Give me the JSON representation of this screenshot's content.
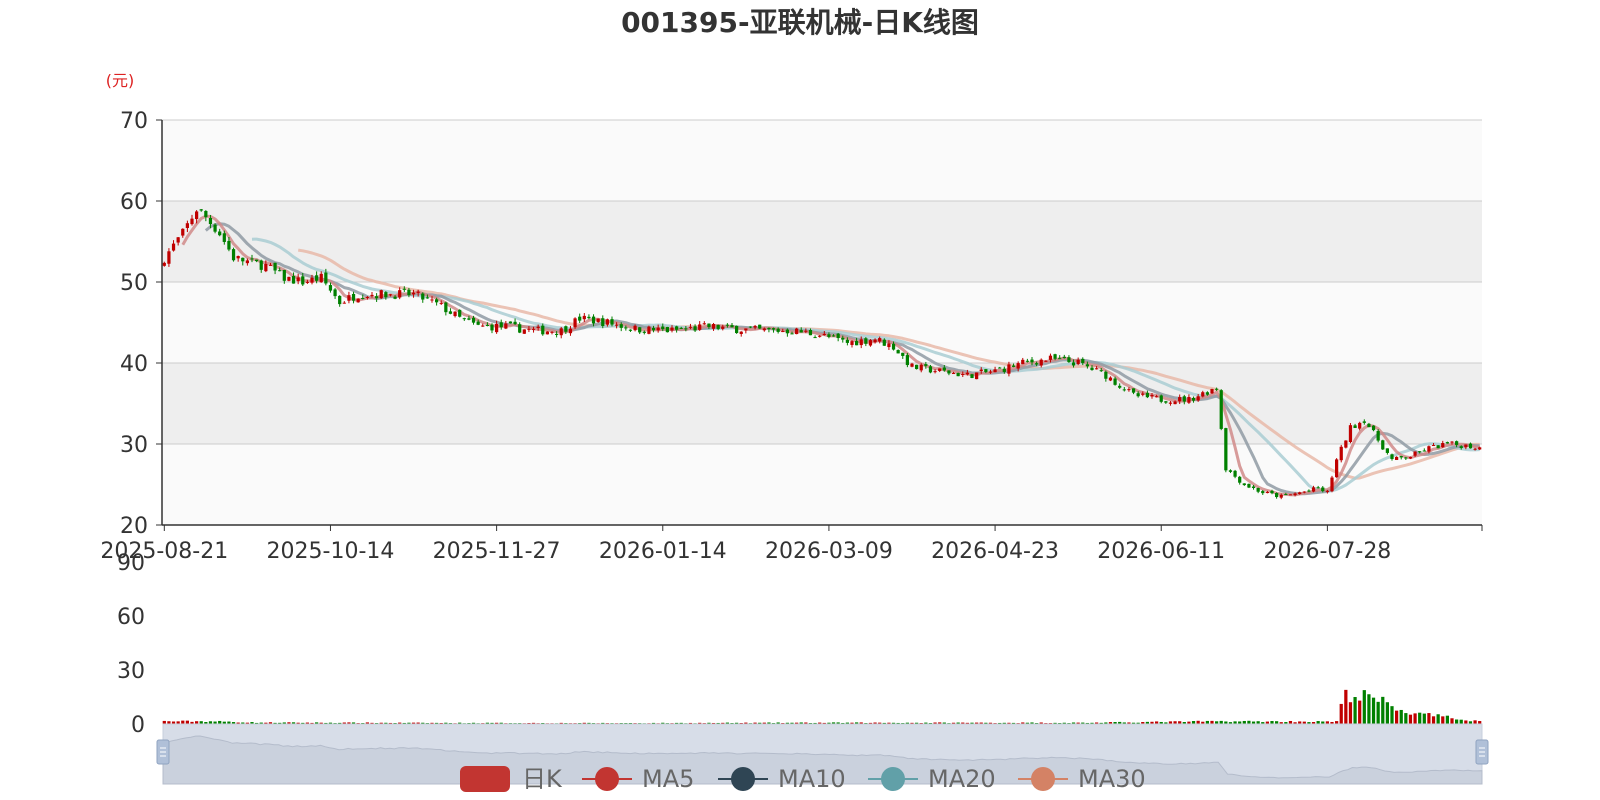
{
  "chart_data": {
    "type": "candlestick",
    "title": "001395-亚联机械-日K线图",
    "y_unit": "(元)",
    "price_axis": {
      "ylim": [
        20,
        70
      ],
      "ticks": [
        "20",
        "30",
        "40",
        "50",
        "60",
        "70"
      ]
    },
    "volume_axis": {
      "ylim": [
        0,
        90
      ],
      "ticks": [
        "0",
        "30",
        "60",
        "90"
      ]
    },
    "x_tick_labels": [
      "2025-08-21",
      "2025-10-14",
      "2025-11-27",
      "2026-01-14",
      "2026-03-09",
      "2026-04-23",
      "2026-06-11",
      "2026-07-28"
    ],
    "x_tick_index": [
      0,
      36,
      72,
      108,
      144,
      180,
      216,
      252
    ],
    "legend_position": "bottom",
    "grid": true,
    "legend": [
      {
        "name": "日K",
        "color": "#c23531"
      },
      {
        "name": "MA5",
        "color": "#c23531"
      },
      {
        "name": "MA10",
        "color": "#2f4554"
      },
      {
        "name": "MA20",
        "color": "#61a0a8"
      },
      {
        "name": "MA30",
        "color": "#d48265"
      }
    ],
    "colors": {
      "up": "#c00000",
      "down": "#008000",
      "ma5": "#d08a88",
      "ma10": "#8f9aa3",
      "ma20": "#a9cdd2",
      "ma30": "#e7b8a8"
    },
    "price_anchors": [
      [
        0,
        53
      ],
      [
        4,
        56
      ],
      [
        7,
        59
      ],
      [
        9,
        58
      ],
      [
        12,
        56
      ],
      [
        15,
        53
      ],
      [
        18,
        52.5
      ],
      [
        22,
        52
      ],
      [
        26,
        50.5
      ],
      [
        30,
        50
      ],
      [
        34,
        50.5
      ],
      [
        38,
        47.5
      ],
      [
        42,
        48.5
      ],
      [
        48,
        48.5
      ],
      [
        54,
        48.5
      ],
      [
        60,
        47
      ],
      [
        64,
        45.5
      ],
      [
        68,
        44.5
      ],
      [
        74,
        44.5
      ],
      [
        80,
        44
      ],
      [
        86,
        44
      ],
      [
        90,
        45.5
      ],
      [
        96,
        45
      ],
      [
        102,
        44.2
      ],
      [
        110,
        44
      ],
      [
        118,
        44.5
      ],
      [
        124,
        44.2
      ],
      [
        130,
        44
      ],
      [
        136,
        44
      ],
      [
        142,
        43.5
      ],
      [
        148,
        42.5
      ],
      [
        154,
        43
      ],
      [
        158,
        42
      ],
      [
        162,
        39.5
      ],
      [
        168,
        39
      ],
      [
        174,
        38.5
      ],
      [
        180,
        39
      ],
      [
        186,
        40
      ],
      [
        192,
        40.5
      ],
      [
        198,
        40
      ],
      [
        204,
        38.5
      ],
      [
        210,
        36
      ],
      [
        216,
        35.5
      ],
      [
        222,
        35.5
      ],
      [
        228,
        37
      ],
      [
        230,
        27
      ],
      [
        234,
        25
      ],
      [
        238,
        24
      ],
      [
        242,
        23.5
      ],
      [
        246,
        24
      ],
      [
        250,
        24.5
      ],
      [
        252,
        24
      ],
      [
        254,
        28
      ],
      [
        257,
        32
      ],
      [
        260,
        33
      ],
      [
        263,
        30.5
      ],
      [
        266,
        28
      ],
      [
        270,
        28.5
      ],
      [
        274,
        29.5
      ],
      [
        278,
        30
      ],
      [
        282,
        29.8
      ],
      [
        285,
        29.5
      ]
    ],
    "volume_anchors": [
      [
        0,
        1.5
      ],
      [
        10,
        1.5
      ],
      [
        20,
        0.8
      ],
      [
        60,
        0.6
      ],
      [
        100,
        0.5
      ],
      [
        140,
        0.7
      ],
      [
        200,
        0.7
      ],
      [
        228,
        1.5
      ],
      [
        254,
        1.3
      ],
      [
        256,
        17
      ],
      [
        262,
        14
      ],
      [
        270,
        6
      ],
      [
        285,
        1.5
      ]
    ]
  }
}
